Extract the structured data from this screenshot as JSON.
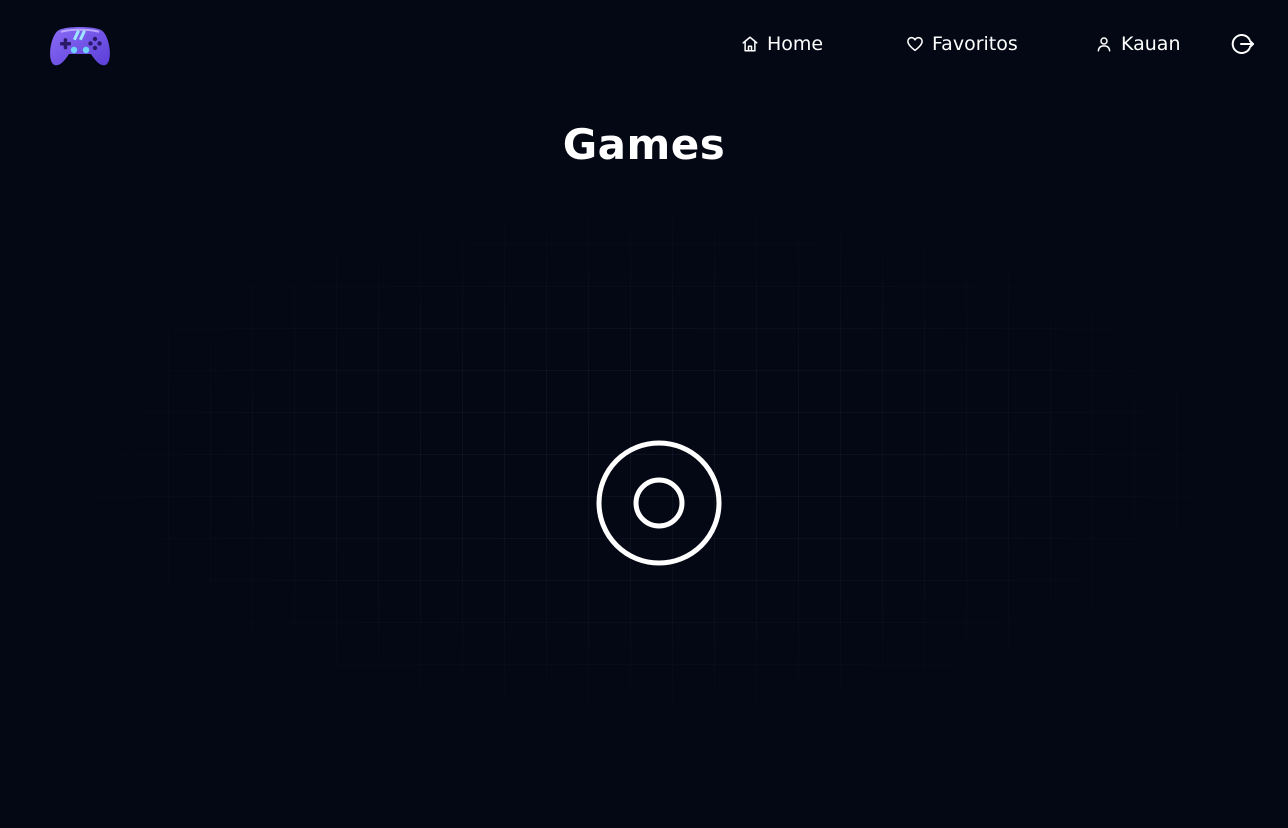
{
  "header": {
    "logo_icon": "gamepad-logo-icon",
    "nav": {
      "home": {
        "label": "Home",
        "icon": "home-icon"
      },
      "favorites": {
        "label": "Favoritos",
        "icon": "heart-icon"
      },
      "user": {
        "label": "Kauan",
        "icon": "user-icon"
      }
    },
    "logout_icon": "logout-icon"
  },
  "main": {
    "title": "Games",
    "loading_indicator": "spinner-icon"
  },
  "colors": {
    "background": "#040814",
    "text": "#ffffff",
    "logo_primary": "#7c5cf0",
    "logo_accent": "#6fd3f5"
  }
}
